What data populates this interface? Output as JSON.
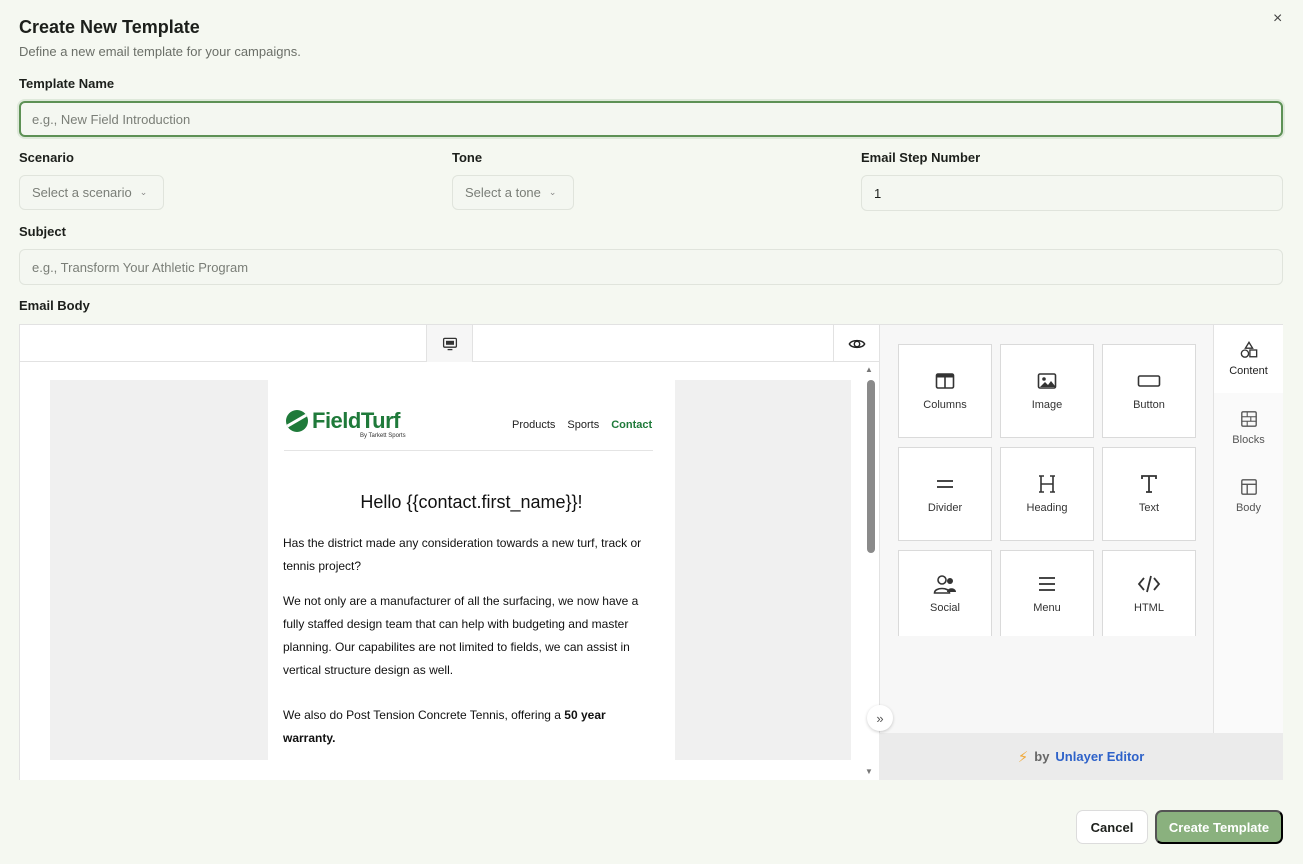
{
  "dialog": {
    "title": "Create New Template",
    "subtitle": "Define a new email template for your campaigns.",
    "close_icon": "×"
  },
  "form": {
    "template_name": {
      "label": "Template Name",
      "placeholder": "e.g., New Field Introduction"
    },
    "scenario": {
      "label": "Scenario",
      "placeholder": "Select a scenario"
    },
    "tone": {
      "label": "Tone",
      "placeholder": "Select a tone"
    },
    "email_step": {
      "label": "Email Step Number",
      "value": "1"
    },
    "subject": {
      "label": "Subject",
      "placeholder": "e.g., Transform Your Athletic Program"
    },
    "email_body": {
      "label": "Email Body"
    }
  },
  "email_preview": {
    "logo_text": "FieldTurf",
    "logo_sub": "By Tarkett Sports",
    "nav": [
      "Products",
      "Sports",
      "Contact"
    ],
    "greeting": "Hello {{contact.first_name}}!",
    "p1": "Has the district made any consideration towards a new turf, track or tennis project?",
    "p2": "We not only are a manufacturer of all the surfacing, we now have a fully staffed design team that can help with budgeting and master planning. Our capabilites are not limited to fields, we can assist in vertical structure design as well.",
    "p3_prefix": "We also do Post Tension Concrete Tennis, offering a ",
    "p3_bold": "50 year warranty."
  },
  "tools": [
    {
      "label": "Columns",
      "icon": "columns-icon"
    },
    {
      "label": "Image",
      "icon": "image-icon"
    },
    {
      "label": "Button",
      "icon": "button-icon"
    },
    {
      "label": "Divider",
      "icon": "divider-icon"
    },
    {
      "label": "Heading",
      "icon": "heading-icon"
    },
    {
      "label": "Text",
      "icon": "text-icon"
    },
    {
      "label": "Social",
      "icon": "social-icon"
    },
    {
      "label": "Menu",
      "icon": "menu-icon"
    },
    {
      "label": "HTML",
      "icon": "html-icon"
    }
  ],
  "tabs": [
    {
      "label": "Content",
      "icon": "shapes-icon"
    },
    {
      "label": "Blocks",
      "icon": "blocks-icon"
    },
    {
      "label": "Body",
      "icon": "body-layout-icon"
    }
  ],
  "powered": {
    "by": "by",
    "brand": "Unlayer Editor"
  },
  "buttons": {
    "cancel": "Cancel",
    "create": "Create Template"
  },
  "colors": {
    "accent": "#5d9155",
    "create_button": "#8ab17e",
    "brand_blue": "#2e62c9",
    "fieldturf_green": "#1f7a3a"
  }
}
